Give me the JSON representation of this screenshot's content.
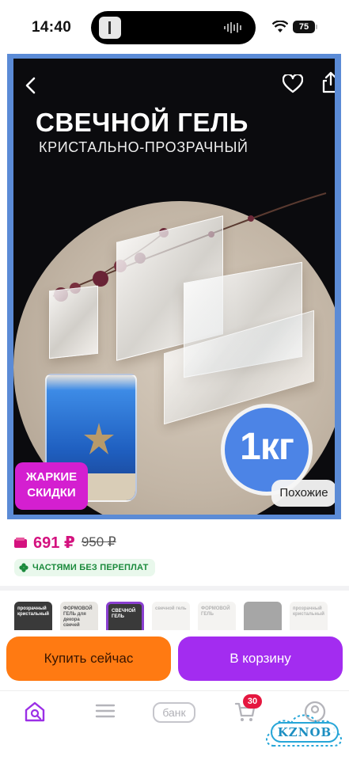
{
  "status_bar": {
    "time": "14:40",
    "battery": "75"
  },
  "product_image": {
    "title": "СВЕЧНОЙ ГЕЛЬ",
    "subtitle": "КРИСТАЛЬНО-ПРОЗРАЧНЫЙ",
    "weight_badge": "1кг",
    "hot_badge_line1": "ЖАРКИЕ",
    "hot_badge_line2": "СКИДКИ",
    "similar_button": "Похожие"
  },
  "price": {
    "current": "691 ₽",
    "old": "950 ₽",
    "installment_label": "ЧАСТЯМИ БЕЗ ПЕРЕПЛАТ"
  },
  "variants": [
    {
      "caption": "прозрачный кристальный",
      "style": "dark"
    },
    {
      "caption": "ФОРМОВОЙ ГЕЛЬ для декора свечей",
      "style": "light"
    },
    {
      "caption": "СВЕЧНОЙ ГЕЛЬ",
      "style": "selected"
    },
    {
      "caption": "свечной гель",
      "style": "faded"
    },
    {
      "caption": "ФОРМОВОЙ ГЕЛЬ",
      "style": "faded"
    },
    {
      "caption": "",
      "style": "faded"
    },
    {
      "caption": "прозрачный кристальный",
      "style": "faded"
    }
  ],
  "actions": {
    "buy_now": "Купить сейчас",
    "add_to_cart": "В корзину"
  },
  "nav": {
    "bank_label": "банк",
    "cart_count": "30"
  },
  "watermark": "KZNOB",
  "colors": {
    "price": "#d4127f",
    "buy": "#ff7a12",
    "cart": "#a32cf0",
    "badge": "#d41fd0",
    "installment": "#1b8a3c"
  }
}
